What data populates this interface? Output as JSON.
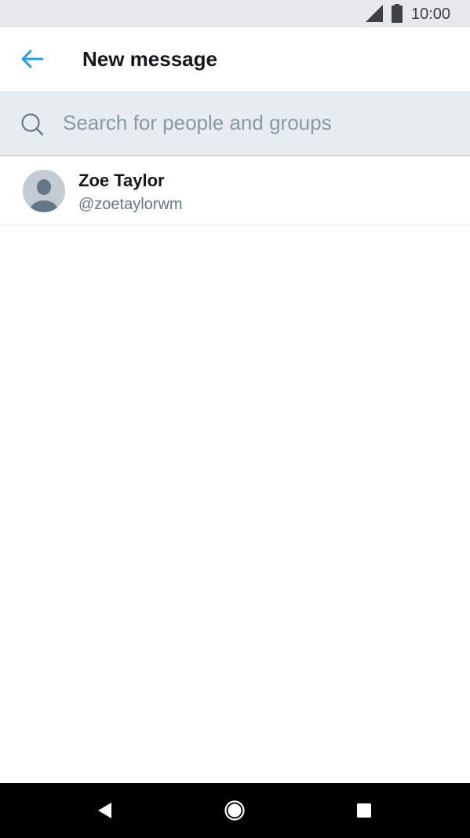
{
  "status_bar": {
    "time": "10:00",
    "signal_icon": "cell-signal-icon",
    "battery_icon": "battery-icon"
  },
  "header": {
    "back_icon": "arrow-left-icon",
    "title": "New message"
  },
  "search": {
    "icon": "search-icon",
    "placeholder": "Search for people and groups",
    "value": ""
  },
  "results": [
    {
      "name": "Zoe Taylor",
      "handle": "@zoetaylorwm",
      "avatar_icon": "default-avatar-icon"
    }
  ],
  "nav_bar": {
    "back_icon": "nav-back-icon",
    "home_icon": "nav-home-icon",
    "recents_icon": "nav-recents-icon"
  },
  "colors": {
    "accent": "#1da1f2",
    "status_bar_bg": "#e6e8eb",
    "search_bg": "#e6ecf0",
    "placeholder": "#8899a6",
    "secondary_text": "#657786",
    "primary_text": "#14171a",
    "nav_bar_bg": "#000000"
  }
}
